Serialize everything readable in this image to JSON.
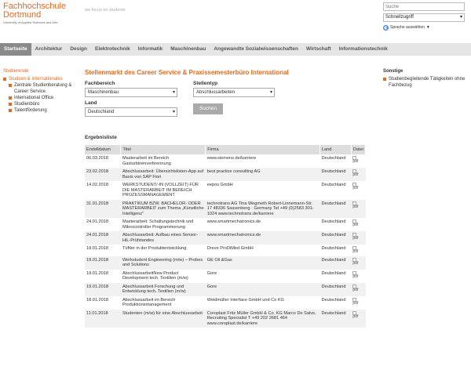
{
  "header": {
    "logo_line1": "Fachhochschule",
    "logo_line2": "Dortmund",
    "logo_line3": "University of Applied Sciences and Arts",
    "motto": "we focus on students",
    "search_placeholder": "Suche",
    "quick_access": "Schnellzugriff",
    "language": "Sprache auswählen",
    "language_sep": "▼"
  },
  "nav": [
    "Startseite",
    "Architektur",
    "Design",
    "Elektrotechnik",
    "Informatik",
    "Maschinenbau",
    "Angewandte Sozialwissenschaften",
    "Wirtschaft",
    "Informationstechnik"
  ],
  "sidebar": {
    "root": "Studierende",
    "items": [
      {
        "label": "Studium & Internationales",
        "current": true,
        "level": 0
      },
      {
        "label": "Zentrale Studienberatung & Career Service",
        "current": false,
        "level": 1
      },
      {
        "label": "International Office",
        "current": false,
        "level": 1
      },
      {
        "label": "Studienbüro",
        "current": false,
        "level": 1
      },
      {
        "label": "Talentförderung",
        "current": false,
        "level": 1
      }
    ]
  },
  "main": {
    "title": "Stellenmarkt des Career Service & Praxissemesterbüro International",
    "fachbereich_label": "Fachbereich",
    "fachbereich_value": "Maschinenbau",
    "stellentyp_label": "Stellentyp",
    "stellentyp_value": "Abschlussarbeiten",
    "land_label": "Land",
    "land_value": "Deutschland",
    "search_button": "Suchen",
    "results_title": "Ergebnisliste"
  },
  "table": {
    "headers": [
      "Erstelldatum",
      "Titel",
      "Firma",
      "Land",
      "Datei"
    ],
    "rows": [
      [
        "06.03.2018",
        "Masterarbeit im Bereich Gasturbinenverbrennung",
        "www.siemens.de/karriere",
        "Deutschland",
        "pdf"
      ],
      [
        "23.02.2018",
        "Abschlussarbeit: Übersichtslisten-App auf Basis von SAP Fiori",
        "best practice consulting AG",
        "Deutschland",
        "pdf"
      ],
      [
        "14.02.2018",
        "WERKSTUDENT/-IN (VOLLZEIT) FÜR DIE MASTERARBEIT IM BEREICH PROZESSMANAGEMENT",
        "eepos GmbH",
        "Deutschland",
        "pdf"
      ],
      [
        "31.01.2018",
        "PRAKTIKUM BZW. BACHELOR- ODER MASTERARBEIT zum Thema „Künstliche Intelligenz“",
        "technotrans AG Tina Wegmeth Robert-Linnemann-Str. 17 48336 Sassenberg · Germany Tel +49 (0)2583 301-1024 www.technotrans.de/karriere",
        "Deutschland",
        "pdf"
      ],
      [
        "24.01.2018",
        "Masterarbeit: Schaltungstechnik und Mikrocontroller Programmierung",
        "www.smartmechatronics.de",
        "Deutschland",
        "pdf"
      ],
      [
        "24.01.2018",
        "Abschlussarbeit: Aufbau eines Sensor-HiL-Prüfstandes",
        "www.smartmechatronics.de",
        "Deutschland",
        "pdf"
      ],
      [
        "19.01.2018",
        "Tüftler in der Produktentwicklung",
        "Dreve ProDiMed GmbH",
        "Deutschland",
        "pdf"
      ],
      [
        "19.01.2018",
        "Werkstudent Engineering (m/w) – Probes and Solutions",
        "GE Oil &Gas",
        "Deutschland",
        "pdf"
      ],
      [
        "19.01.2018",
        "AbschlussarbeitNew Product Development tech. Textilien (m/w)",
        "Gore",
        "Deutschland",
        "pdf"
      ],
      [
        "19.01.2018",
        "Abschlussarbeit Forschung und Entwicklung tech. Textilien (m/w)",
        "Gore",
        "Deutschland",
        "pdf"
      ],
      [
        "18.01.2018",
        "Abschlussarbeit im Bereich Produktionsmanagement",
        "Weidmüller Interface GmbH und Co KG",
        "Deutschland",
        "pdf"
      ],
      [
        "11.01.2018",
        "Studenten (m/w) für eine Abschlussarbeit",
        "Coroplast Fritz Müller GmbH & Co. KG Marco De Salve, Recruiting Specialist T +49 202 2681 464 www.coroplast.de/karriere",
        "Deutschland",
        "pdf"
      ]
    ]
  },
  "right": {
    "heading": "Sonstige",
    "items": [
      "Studienbegleitende Tätigkeiten ohne Fachbezug"
    ]
  },
  "colors": {
    "accent": "#e8691b",
    "nav_bg": "#e5e5e5",
    "nav_active": "#8a8a8a"
  }
}
